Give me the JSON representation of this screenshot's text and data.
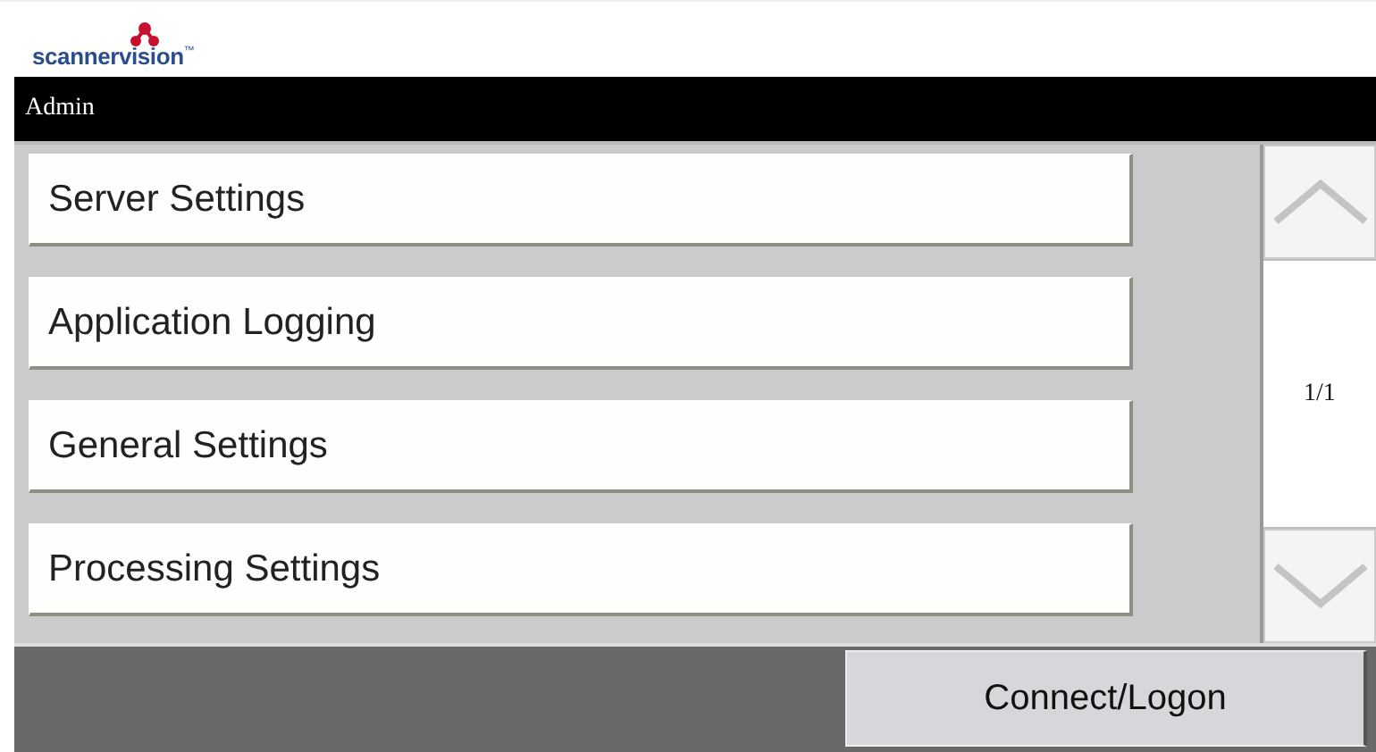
{
  "logo": {
    "text": "scannervision",
    "mark": "™"
  },
  "title_bar": {
    "title": "Admin"
  },
  "menu_items": [
    "Server Settings",
    "Application Logging",
    "General Settings",
    "Processing Settings"
  ],
  "pager": {
    "page": "1/1"
  },
  "footer": {
    "button": "Connect/Logon"
  }
}
